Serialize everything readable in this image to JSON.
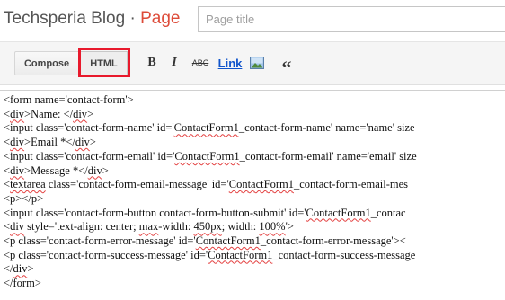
{
  "header": {
    "blog_name": "Techsperia Blog",
    "separator": " · ",
    "page_label": "Page",
    "title_placeholder": "Page title",
    "title_value": ""
  },
  "toolbar": {
    "compose_label": "Compose",
    "html_label": "HTML",
    "bold_label": "B",
    "italic_label": "I",
    "strike_label": "ABC",
    "link_label": "Link",
    "quote_label": "“"
  },
  "colors": {
    "accent": "#dd4b39",
    "highlight_border": "#e8192c",
    "link": "#1155cc"
  },
  "editor": {
    "lines": [
      "<form name='contact-form'>",
      "<div>Name: </div>",
      "<input class='contact-form-name' id='ContactForm1_contact-form-name' name='name' size",
      "<div>Email *</div>",
      "<input class='contact-form-email' id='ContactForm1_contact-form-email' name='email' size",
      "<div>Message *</div>",
      "<textarea class='contact-form-email-message' id='ContactForm1_contact-form-email-mes",
      "<p></p>",
      "<input class='contact-form-button contact-form-button-submit' id='ContactForm1_contac",
      "<div style='text-align: center; max-width: 450px; width: 100%'>",
      "<p class='contact-form-error-message' id='ContactForm1_contact-form-error-message'><",
      "<p class='contact-form-success-message' id='ContactForm1_contact-form-success-message",
      "</div>",
      "</form>"
    ]
  }
}
